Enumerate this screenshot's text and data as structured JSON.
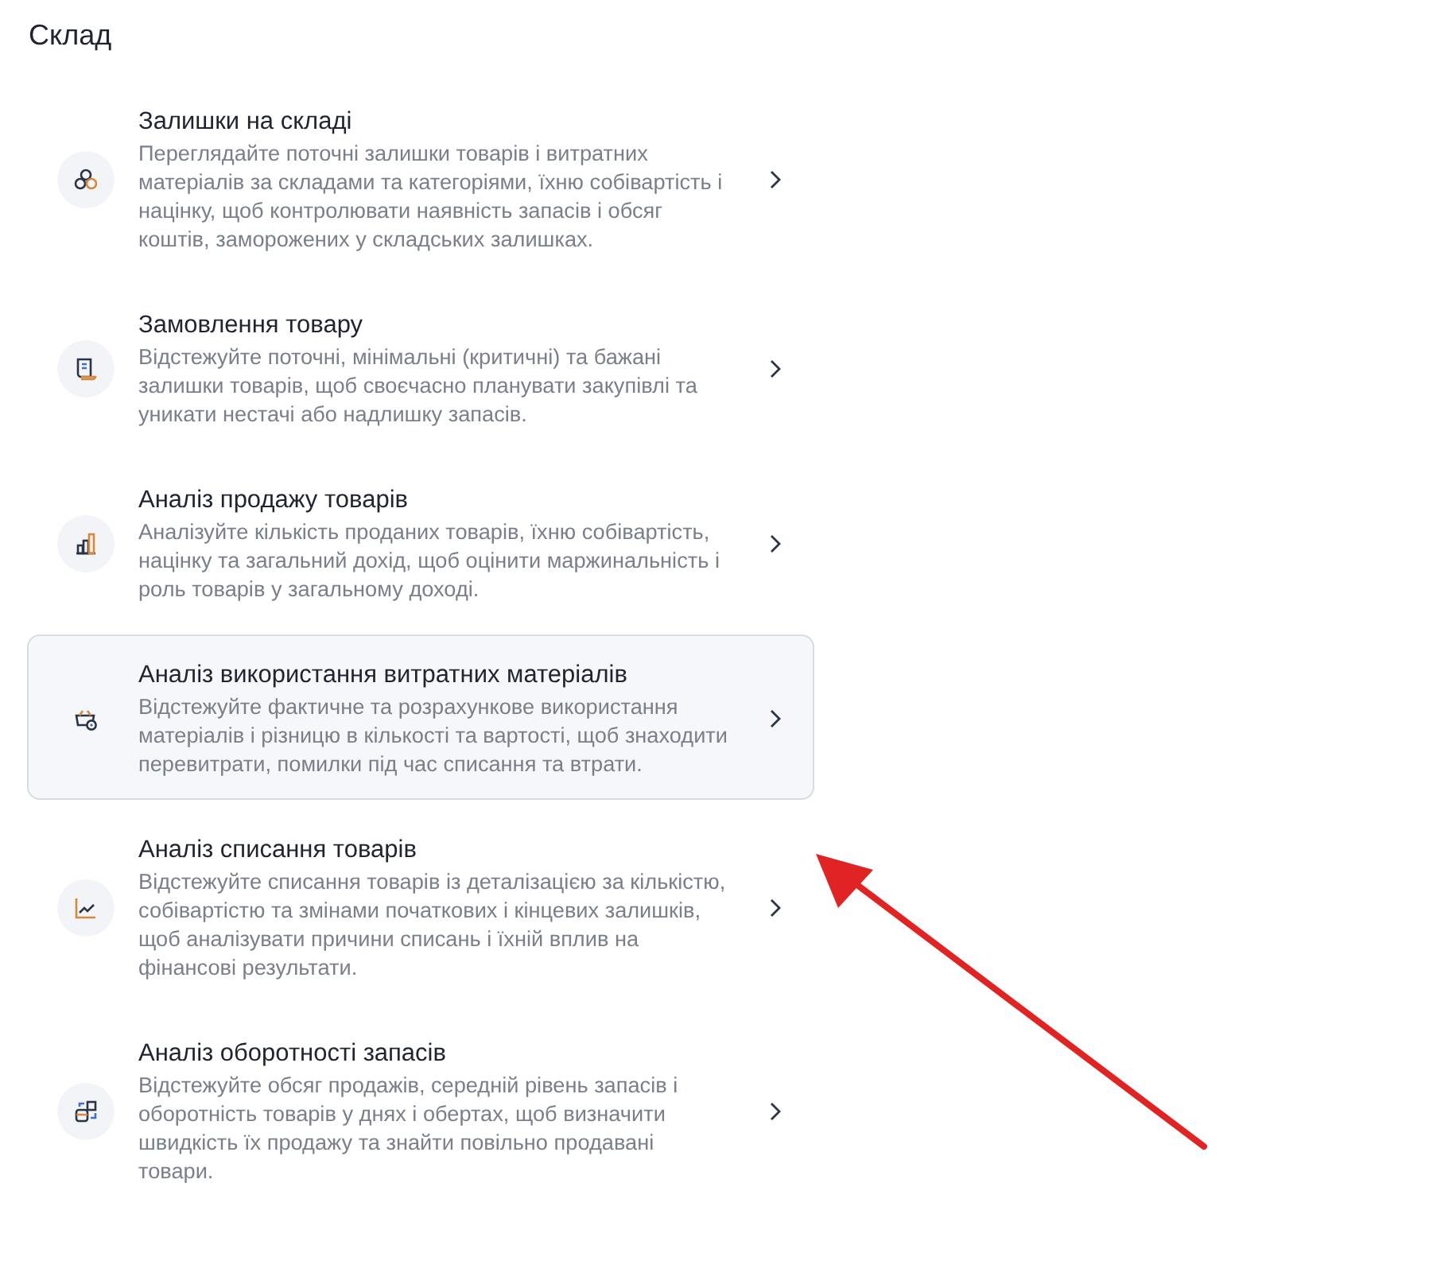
{
  "section_title": "Склад",
  "items": [
    {
      "title": "Залишки на складі",
      "description": "Переглядайте поточні залишки товарів і витратних матеріалів за складами та категоріями, їхню собівартість і націнку, щоб контролювати наявність запасів і обсяг коштів, заморожених у складських залишках.",
      "selected": false
    },
    {
      "title": "Замовлення товару",
      "description": "Відстежуйте поточні, мінімальні (критичні) та бажані залишки товарів, щоб своєчасно планувати закупівлі та уникати нестачі або надлишку запасів.",
      "selected": false
    },
    {
      "title": "Аналіз продажу товарів",
      "description": "Аналізуйте кількість проданих товарів, їхню собівартість, націнку та загальний дохід, щоб оцінити маржинальність і роль товарів у загальному доході.",
      "selected": false
    },
    {
      "title": "Аналіз використання витратних матеріалів",
      "description": "Відстежуйте фактичне та розрахункове використання матеріалів і різницю в кількості та вартості, щоб знаходити перевитрати, помилки під час списання та втрати.",
      "selected": true
    },
    {
      "title": "Аналіз списання товарів",
      "description": "Відстежуйте списання товарів із деталізацією за кількістю, собівартістю та змінами початкових і кінцевих залишків, щоб аналізувати причини списань і їхній вплив на фінансові результати.",
      "selected": false
    },
    {
      "title": "Аналіз оборотності запасів",
      "description": "Відстежуйте обсяг продажів, середній рівень запасів і оборотність товарів у днях і обертах, щоб визначити швидкість їх продажу та знайти повільно продавані товари.",
      "selected": false
    }
  ]
}
